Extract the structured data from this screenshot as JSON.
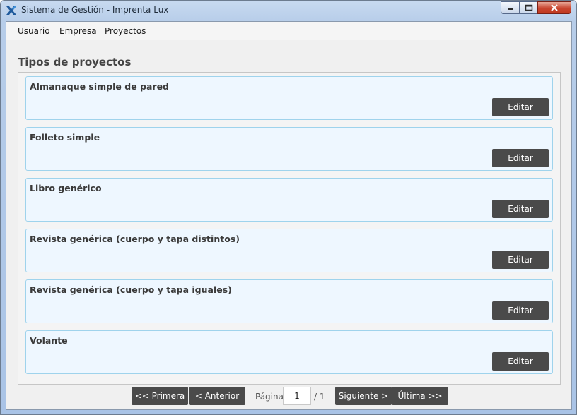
{
  "window": {
    "title": "Sistema de Gestión - Imprenta Lux",
    "icon": "app-x-icon",
    "controls": [
      "minimize-icon",
      "maximize-icon",
      "close-icon"
    ]
  },
  "menu": {
    "items": [
      {
        "label": "Usuario"
      },
      {
        "label": "Empresa"
      },
      {
        "label": "Proyectos"
      }
    ]
  },
  "page": {
    "title": "Tipos de proyectos"
  },
  "project_types": [
    {
      "name": "Almanaque simple de pared",
      "action": "Editar"
    },
    {
      "name": "Folleto simple",
      "action": "Editar"
    },
    {
      "name": "Libro genérico",
      "action": "Editar"
    },
    {
      "name": "Revista genérica (cuerpo y tapa distintos)",
      "action": "Editar"
    },
    {
      "name": "Revista genérica (cuerpo y tapa iguales)",
      "action": "Editar"
    },
    {
      "name": "Volante",
      "action": "Editar"
    }
  ],
  "pagination": {
    "first": "<< Primera",
    "prev": "< Anterior",
    "page_label": "Página",
    "current_page": "1",
    "total_label": "/ 1",
    "next": "Siguiente >",
    "last": "Última >>"
  },
  "colors": {
    "card_background": "#eef7ff",
    "card_border": "#9fd3ec",
    "button_background": "#4a4a4a",
    "button_text": "#ffffff"
  }
}
